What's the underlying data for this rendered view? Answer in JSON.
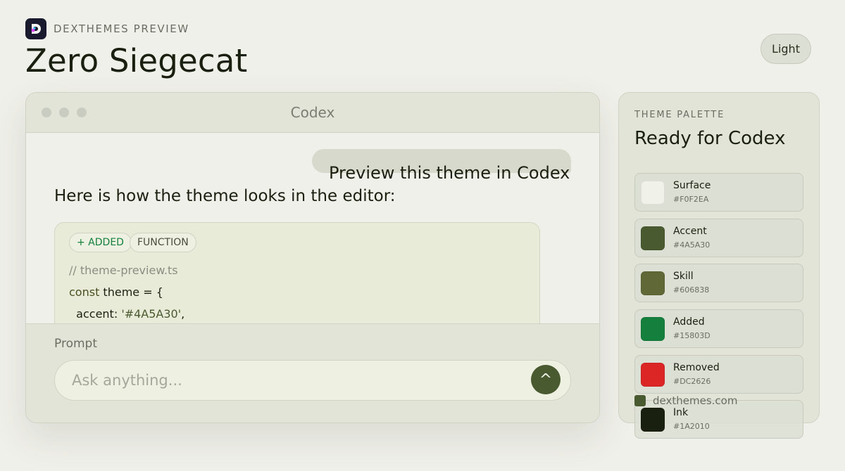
{
  "brand": {
    "label": "DEXTHEMES PREVIEW",
    "logo_letter": "D"
  },
  "page": {
    "title": "Zero Siegecat",
    "mode_label": "Light"
  },
  "window": {
    "title": "Codex",
    "user_message": "Preview this theme in Codex",
    "assistant_message": "Here is how the theme looks in the editor:",
    "tags": [
      "+ ADDED",
      "FUNCTION"
    ],
    "code": {
      "comment": "// theme-preview.ts",
      "line2_kw": "const",
      "line2_rest": " theme = {",
      "line3_key": "  accent: ",
      "line3_val": "'#4A5A30'",
      "line3_end": ","
    },
    "prompt": {
      "label": "Prompt",
      "placeholder": "Ask anything...",
      "send_icon": "^"
    }
  },
  "palette": {
    "eyebrow": "THEME PALETTE",
    "title": "Ready for Codex",
    "swatches": [
      {
        "name": "Surface",
        "hex": "#F0F2EA"
      },
      {
        "name": "Accent",
        "hex": "#4A5A30"
      },
      {
        "name": "Skill",
        "hex": "#606838"
      },
      {
        "name": "Added",
        "hex": "#15803D"
      },
      {
        "name": "Removed",
        "hex": "#DC2626"
      },
      {
        "name": "Ink",
        "hex": "#1A2010"
      }
    ]
  },
  "footer": {
    "link": "dexthemes.com"
  },
  "colors": {
    "background": "#f0f0ea",
    "accent": "#4a5a30",
    "added": "#15803d",
    "logo_bg": "#1a1a2e"
  }
}
